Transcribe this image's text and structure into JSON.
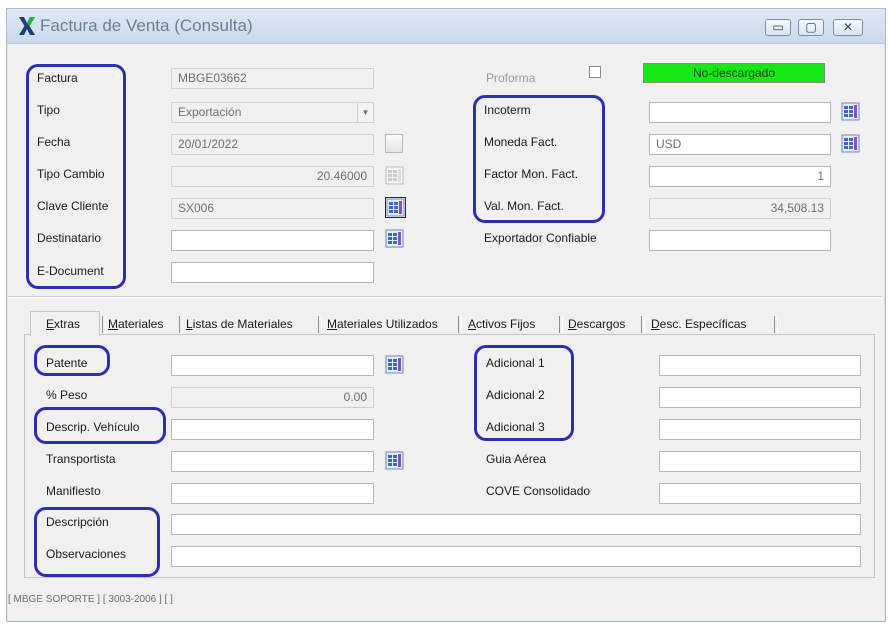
{
  "window": {
    "title": "Factura de Venta (Consulta)",
    "controls": {
      "minimize": "▭",
      "maximize": "▢",
      "close": "✕"
    }
  },
  "header": {
    "factura": {
      "label": "Factura",
      "value": "MBGE03662"
    },
    "tipo": {
      "label": "Tipo",
      "value": "Exportación"
    },
    "fecha": {
      "label": "Fecha",
      "value": "20/01/2022"
    },
    "tipo_cambio": {
      "label": "Tipo Cambio",
      "value": "20.46000"
    },
    "clave_cliente": {
      "label": "Clave Cliente",
      "value": "SX006"
    },
    "destinatario": {
      "label": "Destinatario",
      "value": ""
    },
    "e_document": {
      "label": "E-Document",
      "value": ""
    },
    "proforma": {
      "label": "Proforma",
      "checked": false
    },
    "status_badge": "No-descargado",
    "status_color": "#16e816",
    "incoterm": {
      "label": "Incoterm",
      "value": ""
    },
    "moneda_fact": {
      "label": "Moneda Fact.",
      "value": "USD"
    },
    "factor_mon_fact": {
      "label": "Factor Mon. Fact.",
      "value": "1"
    },
    "val_mon_fact": {
      "label": "Val. Mon. Fact.",
      "value": "34,508.13"
    },
    "exportador_confiable": {
      "label": "Exportador Confiable",
      "value": ""
    }
  },
  "tabs": [
    {
      "label": "Extras",
      "active": true
    },
    {
      "label": "Materiales"
    },
    {
      "label": "Listas de Materiales"
    },
    {
      "label": "Materiales Utilizados"
    },
    {
      "label": "Activos Fijos"
    },
    {
      "label": "Descargos"
    },
    {
      "label": "Desc. Específicas"
    }
  ],
  "extras": {
    "patente": {
      "label": "Patente",
      "value": ""
    },
    "peso": {
      "label": "% Peso",
      "value": "0.00"
    },
    "descrip_vehiculo": {
      "label": "Descrip. Vehículo",
      "value": ""
    },
    "transportista": {
      "label": "Transportista",
      "value": ""
    },
    "manifiesto": {
      "label": "Manifiesto",
      "value": ""
    },
    "descripcion": {
      "label": "Descripción",
      "value": ""
    },
    "observaciones": {
      "label": "Observaciones",
      "value": ""
    },
    "adicional_1": {
      "label": "Adicional 1",
      "value": ""
    },
    "adicional_2": {
      "label": "Adicional 2",
      "value": ""
    },
    "adicional_3": {
      "label": "Adicional 3",
      "value": ""
    },
    "guia_aerea": {
      "label": "Guia Aérea",
      "value": ""
    },
    "cove_consolidado": {
      "label": "COVE Consolidado",
      "value": ""
    }
  },
  "statusbar": "[ MBGE SOPORTE ]  [ 3003-2006 ]  [  ]",
  "colors": {
    "annotation": "#2d2fb3",
    "titlebar": "#cad9ec"
  },
  "icons": [
    "app-x-icon",
    "lookup-grid-icon",
    "calendar-button-icon",
    "dropdown-arrow-icon"
  ]
}
